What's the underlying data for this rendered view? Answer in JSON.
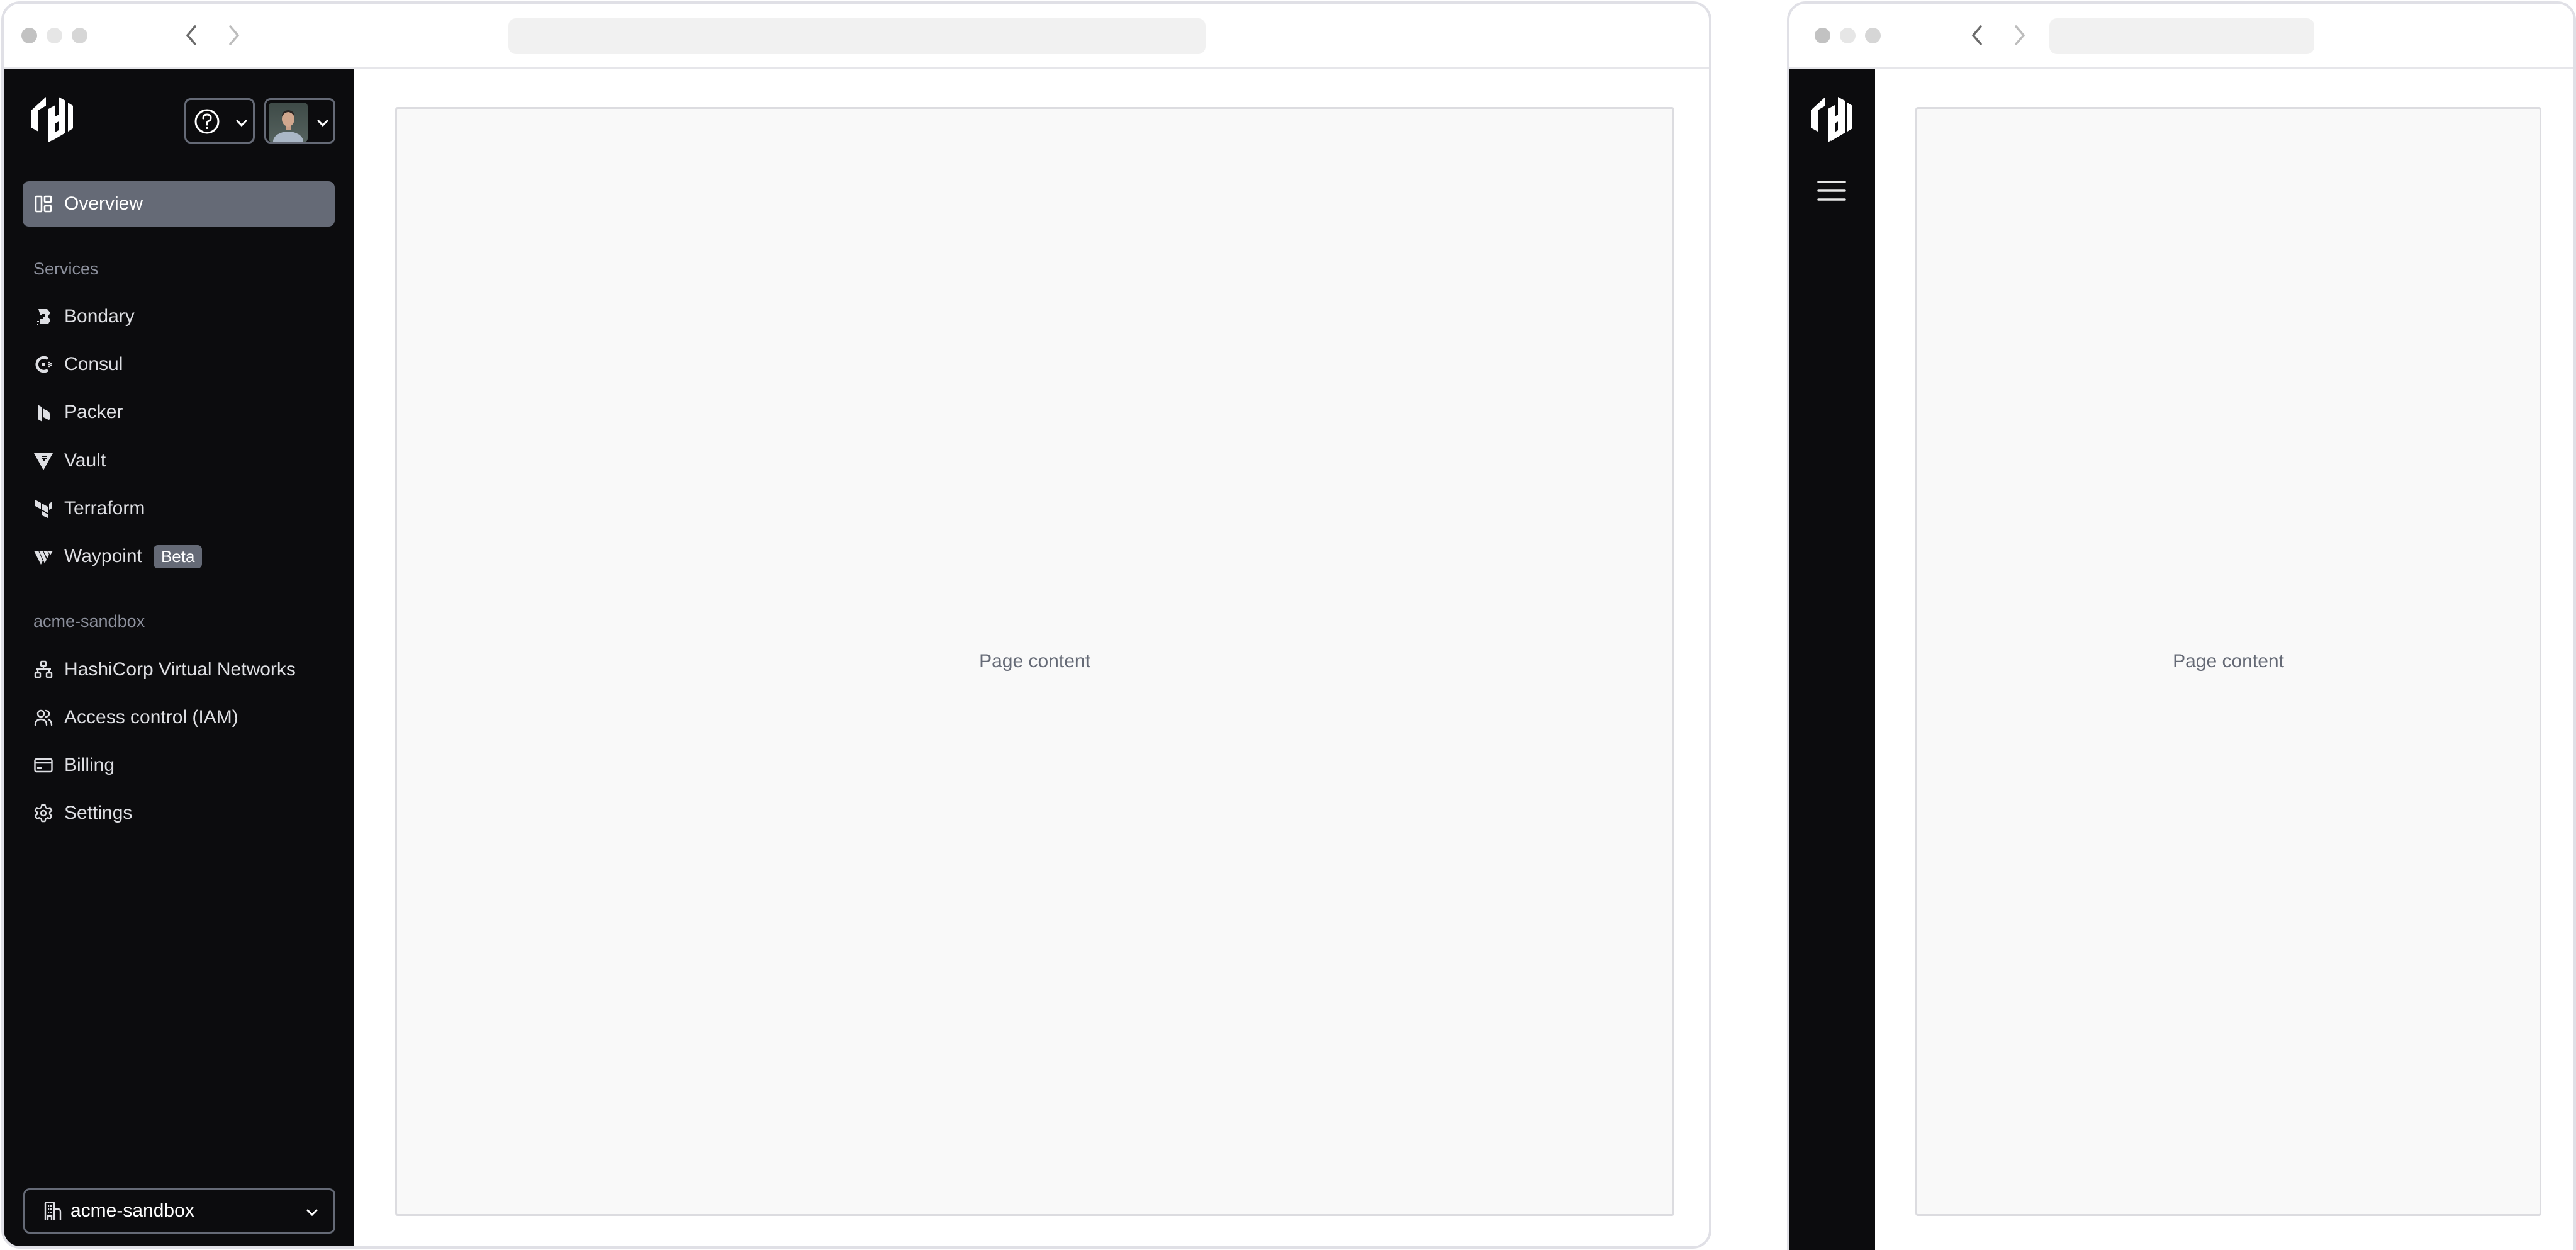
{
  "desktop_window": {
    "traffic_lights": [
      "close",
      "minimize",
      "maximize"
    ],
    "nav": {
      "back_icon": "chevron-left-icon",
      "forward_icon": "chevron-right-icon"
    },
    "url_bar": {
      "value": ""
    },
    "sidebar": {
      "logo": "hashicorp-logo",
      "help_button": {
        "icon": "help-circle-icon",
        "dropdown_icon": "chevron-down-icon"
      },
      "user_button": {
        "icon": "avatar",
        "dropdown_icon": "chevron-down-icon"
      },
      "primary_item": {
        "label": "Overview",
        "icon": "dashboard-icon",
        "active": true
      },
      "sections": [
        {
          "title": "Services",
          "items": [
            {
              "label": "Bondary",
              "icon": "boundary-icon"
            },
            {
              "label": "Consul",
              "icon": "consul-icon"
            },
            {
              "label": "Packer",
              "icon": "packer-icon"
            },
            {
              "label": "Vault",
              "icon": "vault-icon"
            },
            {
              "label": "Terraform",
              "icon": "terraform-icon"
            },
            {
              "label": "Waypoint",
              "icon": "waypoint-icon",
              "badge": "Beta"
            }
          ]
        },
        {
          "title": "acme-sandbox",
          "items": [
            {
              "label": "HashiCorp Virtual Networks",
              "icon": "network-icon"
            },
            {
              "label": "Access control (IAM)",
              "icon": "users-icon"
            },
            {
              "label": "Billing",
              "icon": "credit-card-icon"
            },
            {
              "label": "Settings",
              "icon": "gear-icon"
            }
          ]
        }
      ],
      "org_switcher": {
        "label": "acme-sandbox",
        "icon": "building-icon",
        "dropdown_icon": "chevron-down-icon"
      }
    },
    "main": {
      "placeholder_text": "Page content"
    }
  },
  "mobile_window": {
    "traffic_lights": [
      "close",
      "minimize",
      "maximize"
    ],
    "nav": {
      "back_icon": "chevron-left-icon",
      "forward_icon": "chevron-right-icon"
    },
    "url_bar": {
      "value": ""
    },
    "sidebar": {
      "logo": "hashicorp-logo",
      "menu_icon": "hamburger-menu-icon"
    },
    "main": {
      "placeholder_text": "Page content"
    }
  },
  "colors": {
    "sidebar_bg": "#0c0c0e",
    "active_item_bg": "#656a76",
    "section_label": "#8c909c",
    "content_bg": "#f9f9f9",
    "content_text": "#656a76"
  }
}
